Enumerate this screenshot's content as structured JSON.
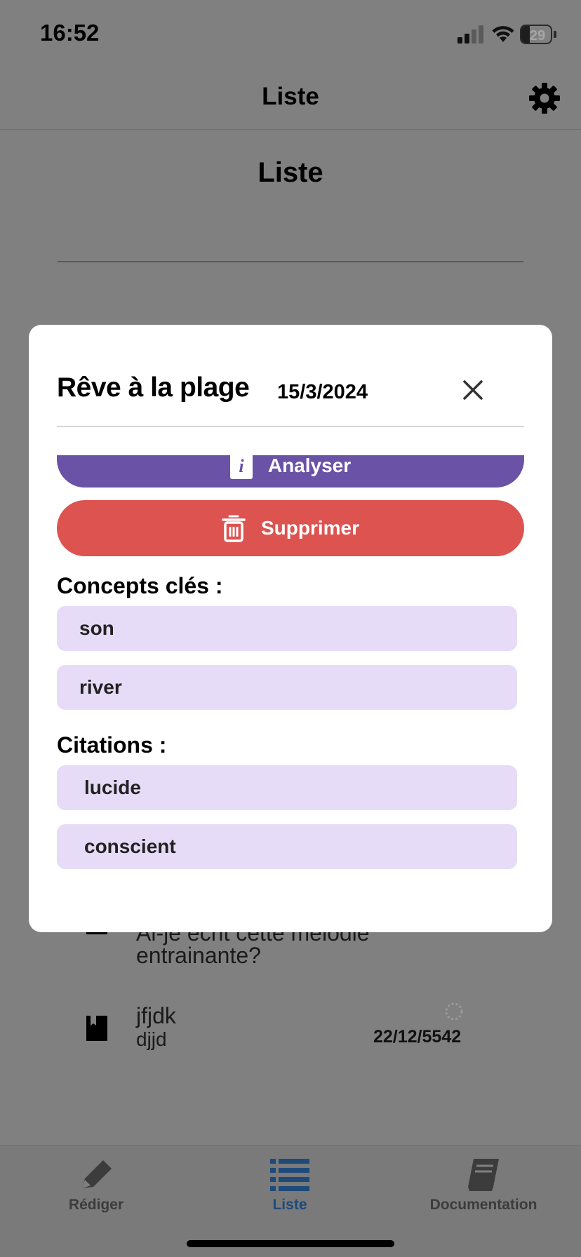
{
  "status_bar": {
    "time": "16:52",
    "battery": "29",
    "battery_level": 0.29
  },
  "header": {
    "title": "Liste"
  },
  "page": {
    "title": "Liste"
  },
  "background_list": [
    {
      "title": "Ai-je écrit cette mélodie",
      "subtitle": "entrainante?",
      "date": ""
    },
    {
      "title": "jfjdk",
      "subtitle": "djjd",
      "date": "22/12/5542"
    }
  ],
  "modal": {
    "title": "Rêve à la plage",
    "date": "15/3/2024",
    "analyse_label": "Analyser",
    "delete_label": "Supprimer",
    "concepts_title": "Concepts clés :",
    "concepts": [
      "son",
      "river"
    ],
    "quotes_title": "Citations :",
    "quotes": [
      "lucide",
      "conscient"
    ]
  },
  "tabs": [
    {
      "label": "Rédiger",
      "icon": "pencil-icon",
      "active": false
    },
    {
      "label": "Liste",
      "icon": "list-icon",
      "active": true
    },
    {
      "label": "Documentation",
      "icon": "book-icon",
      "active": false
    }
  ],
  "colors": {
    "overlay": "#808080",
    "analyse_button": "#6a52a6",
    "delete_button": "#dc5350",
    "chip": "#e6dcf7",
    "active_tab": "#1e4a7a"
  }
}
